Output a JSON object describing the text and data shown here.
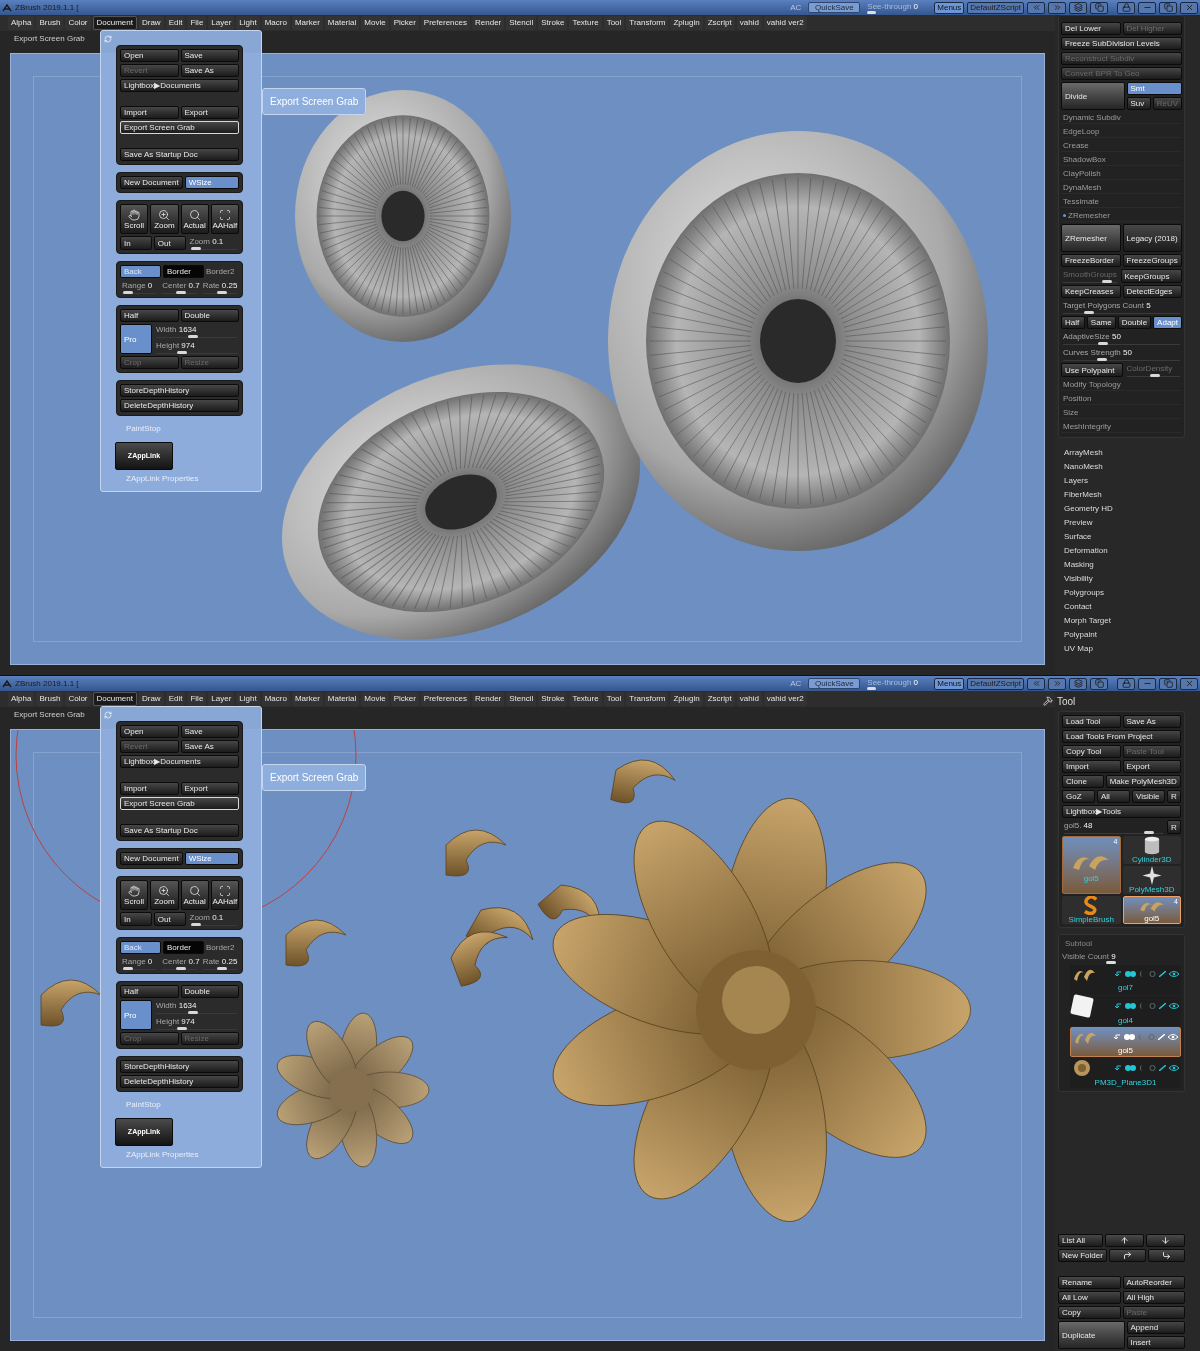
{
  "windows": [
    {
      "title": "ZBrush 2019.1.1 [",
      "topbar": {
        "ac": "AC",
        "quicksave": "QuickSave",
        "see_through": "See-through",
        "see_through_value": "0",
        "level": 0,
        "menus": "Menus",
        "menus_active": true,
        "script": "DefaultZScript"
      },
      "menu_items": [
        {
          "label": "Alpha",
          "selected": false
        },
        {
          "label": "Brush",
          "selected": false
        },
        {
          "label": "Color",
          "selected": false
        },
        {
          "label": "Document",
          "selected": true
        },
        {
          "label": "Draw",
          "selected": false
        },
        {
          "label": "Edit",
          "selected": false
        },
        {
          "label": "File",
          "selected": false
        },
        {
          "label": "Layer",
          "selected": false
        },
        {
          "label": "Light",
          "selected": false
        },
        {
          "label": "Macro",
          "selected": false
        },
        {
          "label": "Marker",
          "selected": false
        },
        {
          "label": "Material",
          "selected": false
        },
        {
          "label": "Movie",
          "selected": false
        },
        {
          "label": "Picker",
          "selected": false
        },
        {
          "label": "Preferences",
          "selected": false
        },
        {
          "label": "Render",
          "selected": false
        },
        {
          "label": "Stencil",
          "selected": false
        },
        {
          "label": "Stroke",
          "selected": false
        },
        {
          "label": "Texture",
          "selected": false
        },
        {
          "label": "Tool",
          "selected": false
        },
        {
          "label": "Transform",
          "selected": false
        },
        {
          "label": "Zplugin",
          "selected": false
        },
        {
          "label": "Zscript",
          "selected": false
        },
        {
          "label": "vahid",
          "selected": false
        },
        {
          "label": "vahid ver2",
          "selected": false
        }
      ],
      "status_text": "Export Screen Grab",
      "canvas": {
        "kind": "eyes"
      },
      "document_menu": {
        "groups": [
          [
            [
              {
                "label": "Open"
              },
              {
                "label": "Save"
              }
            ],
            [
              {
                "label": "Revert",
                "disabled": true
              },
              {
                "label": "Save As"
              }
            ],
            [
              {
                "label": "Lightbox▶Documents"
              }
            ],
            [
              {
                "kind": "spacer"
              }
            ],
            [
              {
                "label": "Import"
              },
              {
                "label": "Export"
              }
            ],
            [
              {
                "label": "Export Screen Grab",
                "hovered": true
              }
            ],
            [
              {
                "kind": "spacer"
              }
            ],
            [
              {
                "label": "Save As Startup Doc"
              }
            ]
          ],
          [
            [
              {
                "label": "New Document"
              },
              {
                "label": "WSize",
                "active": true
              }
            ]
          ],
          [
            [
              {
                "kind": "tool",
                "label": "Scroll"
              },
              {
                "kind": "tool",
                "label": "Zoom"
              },
              {
                "kind": "tool",
                "label": "Actual"
              },
              {
                "kind": "tool",
                "label": "AAHalf"
              }
            ],
            [
              {
                "label": "In"
              },
              {
                "label": "Out"
              },
              {
                "kind": "slider",
                "label": "Zoom",
                "value": "0.1",
                "level": 0.05,
                "wide": true
              }
            ]
          ],
          [
            [
              {
                "label": "Back",
                "active": true,
                "disabled": true
              },
              {
                "kind": "black",
                "label": "Border"
              },
              {
                "kind": "label",
                "label": "Border2"
              }
            ],
            [
              {
                "kind": "slider",
                "label": "Range",
                "value": "0",
                "level": 0.05
              },
              {
                "kind": "slider",
                "label": "Center",
                "value": "0.7",
                "level": 0.55
              },
              {
                "kind": "slider",
                "label": "Rate",
                "value": "0.25",
                "level": 0.6
              }
            ]
          ],
          [
            [
              {
                "label": "Half"
              },
              {
                "label": "Double"
              }
            ],
            [
              {
                "kind": "block",
                "label": "Pro",
                "active": true
              },
              {
                "kind": "stack",
                "rows": [
                  [
                    {
                      "kind": "slider",
                      "label": "Width",
                      "value": "1634",
                      "level": 0.45
                    }
                  ],
                  [
                    {
                      "kind": "slider",
                      "label": "Height",
                      "value": "974",
                      "level": 0.3
                    }
                  ]
                ]
              }
            ],
            [
              {
                "label": "Crop",
                "disabled": true
              },
              {
                "label": "Resize",
                "disabled": true
              }
            ]
          ],
          [
            [
              {
                "label": "StoreDepthHistory"
              }
            ],
            [
              {
                "label": "DeleteDepthHistory"
              }
            ]
          ]
        ],
        "paintstop": "PaintStop",
        "zapplink": "ZAppLink",
        "zapplink_properties": "ZAppLink Properties"
      },
      "tooltip": "Export Screen Grab",
      "right_panel": {
        "kind": "geometry",
        "rows": [
          [
            {
              "label": "Del Lower"
            },
            {
              "label": "Del Higher",
              "disabled": true
            }
          ],
          [
            {
              "label": "Freeze SubDivision Levels"
            }
          ],
          [
            {
              "label": "Reconstruct Subdiv",
              "disabled": true
            }
          ],
          [
            {
              "label": "Convert BPR To Geo",
              "disabled": true
            }
          ],
          [
            {
              "kind": "tall",
              "label": "Divide"
            },
            {
              "kind": "stack",
              "rows": [
                [
                  {
                    "label": "Smt",
                    "active": true
                  }
                ],
                [
                  {
                    "label": "Suv"
                  },
                  {
                    "label": "ReUV",
                    "disabled": true
                  }
                ]
              ]
            }
          ],
          [
            {
              "kind": "header",
              "label": "Dynamic Subdiv",
              "expanded": false
            }
          ],
          [
            {
              "kind": "header",
              "label": "EdgeLoop",
              "expanded": false
            }
          ],
          [
            {
              "kind": "header",
              "label": "Crease",
              "expanded": false
            }
          ],
          [
            {
              "kind": "header",
              "label": "ShadowBox",
              "expanded": false
            }
          ],
          [
            {
              "kind": "header",
              "label": "ClayPolish",
              "expanded": false
            }
          ],
          [
            {
              "kind": "header",
              "label": "DynaMesh",
              "expanded": false
            }
          ],
          [
            {
              "kind": "header",
              "label": "Tessimate",
              "expanded": false
            }
          ],
          [
            {
              "kind": "header",
              "label": "ZRemesher",
              "expanded": true
            }
          ],
          [
            {
              "kind": "tall",
              "label": "ZRemesher"
            },
            {
              "label": "Legacy (2018)"
            }
          ],
          [
            {
              "label": "FreezeBorder"
            },
            {
              "label": "FreezeGroups"
            }
          ],
          [
            {
              "kind": "slider",
              "label": "SmoothGroups",
              "disabled": true,
              "level": 0.9
            },
            {
              "label": "KeepGroups"
            }
          ],
          [
            {
              "label": "KeepCreases"
            },
            {
              "label": "DetectEdges"
            }
          ],
          [
            {
              "kind": "slider",
              "label": "Target Polygons Count",
              "value": "5",
              "level": 0.2
            }
          ],
          {
            "kind": "segmented",
            "items": [
              {
                "label": "Half"
              },
              {
                "label": "Same"
              },
              {
                "label": "Double"
              },
              {
                "label": "Adapt",
                "active": true
              }
            ]
          },
          [
            {
              "kind": "slider",
              "label": "AdaptiveSize",
              "value": "50",
              "level": 0.33
            }
          ],
          [
            {
              "kind": "slider",
              "label": "Curves Strength",
              "value": "50",
              "level": 0.32
            }
          ],
          [
            {
              "label": "Use Polypaint"
            },
            {
              "kind": "slider",
              "label": "ColorDensity",
              "disabled": true,
              "level": 0.55
            }
          ],
          [
            {
              "kind": "header",
              "label": "Modify Topology",
              "expanded": false
            }
          ],
          [
            {
              "kind": "header",
              "label": "Position",
              "expanded": false
            }
          ],
          [
            {
              "kind": "header",
              "label": "Size",
              "expanded": false
            }
          ],
          [
            {
              "kind": "header",
              "label": "MeshIntegrity",
              "expanded": false
            }
          ]
        ],
        "palettes": [
          "ArrayMesh",
          "NanoMesh",
          "Layers",
          "FiberMesh",
          "Geometry HD",
          "Preview",
          "Surface",
          "Deformation",
          "Masking",
          "Visibility",
          "Polygroups",
          "Contact",
          "Morph Target",
          "Polypaint",
          "UV Map"
        ]
      }
    },
    {
      "title": "ZBrush 2019.1.1 [",
      "topbar": {
        "ac": "AC",
        "quicksave": "QuickSave",
        "see_through": "See-through",
        "see_through_value": "0",
        "level": 0,
        "menus": "Menus",
        "menus_active": true,
        "script": "DefaultZScript"
      },
      "menu_items": [
        {
          "label": "Alpha",
          "selected": false
        },
        {
          "label": "Brush",
          "selected": false
        },
        {
          "label": "Color",
          "selected": false
        },
        {
          "label": "Document",
          "selected": true
        },
        {
          "label": "Draw",
          "selected": false
        },
        {
          "label": "Edit",
          "selected": false
        },
        {
          "label": "File",
          "selected": false
        },
        {
          "label": "Layer",
          "selected": false
        },
        {
          "label": "Light",
          "selected": false
        },
        {
          "label": "Macro",
          "selected": false
        },
        {
          "label": "Marker",
          "selected": false
        },
        {
          "label": "Material",
          "selected": false
        },
        {
          "label": "Movie",
          "selected": false
        },
        {
          "label": "Picker",
          "selected": false
        },
        {
          "label": "Preferences",
          "selected": false
        },
        {
          "label": "Render",
          "selected": false
        },
        {
          "label": "Stencil",
          "selected": false
        },
        {
          "label": "Stroke",
          "selected": false
        },
        {
          "label": "Texture",
          "selected": false
        },
        {
          "label": "Tool",
          "selected": false
        },
        {
          "label": "Transform",
          "selected": false
        },
        {
          "label": "Zplugin",
          "selected": false
        },
        {
          "label": "Zscript",
          "selected": false
        },
        {
          "label": "vahid",
          "selected": false
        },
        {
          "label": "vahid ver2",
          "selected": false
        }
      ],
      "status_text": "Export Screen Grab",
      "canvas": {
        "kind": "flowers"
      },
      "document_menu": {
        "groups": [
          [
            [
              {
                "label": "Open"
              },
              {
                "label": "Save"
              }
            ],
            [
              {
                "label": "Revert",
                "disabled": true
              },
              {
                "label": "Save As"
              }
            ],
            [
              {
                "label": "Lightbox▶Documents"
              }
            ],
            [
              {
                "kind": "spacer"
              }
            ],
            [
              {
                "label": "Import"
              },
              {
                "label": "Export"
              }
            ],
            [
              {
                "label": "Export Screen Grab",
                "hovered": true
              }
            ],
            [
              {
                "kind": "spacer"
              }
            ],
            [
              {
                "label": "Save As Startup Doc"
              }
            ]
          ],
          [
            [
              {
                "label": "New Document"
              },
              {
                "label": "WSize",
                "active": true
              }
            ]
          ],
          [
            [
              {
                "kind": "tool",
                "label": "Scroll"
              },
              {
                "kind": "tool",
                "label": "Zoom"
              },
              {
                "kind": "tool",
                "label": "Actual"
              },
              {
                "kind": "tool",
                "label": "AAHalf"
              }
            ],
            [
              {
                "label": "In"
              },
              {
                "label": "Out"
              },
              {
                "kind": "slider",
                "label": "Zoom",
                "value": "0.1",
                "level": 0.05,
                "wide": true
              }
            ]
          ],
          [
            [
              {
                "label": "Back",
                "active": true,
                "disabled": true
              },
              {
                "kind": "black",
                "label": "Border"
              },
              {
                "kind": "label",
                "label": "Border2"
              }
            ],
            [
              {
                "kind": "slider",
                "label": "Range",
                "value": "0",
                "level": 0.05
              },
              {
                "kind": "slider",
                "label": "Center",
                "value": "0.7",
                "level": 0.55
              },
              {
                "kind": "slider",
                "label": "Rate",
                "value": "0.25",
                "level": 0.6
              }
            ]
          ],
          [
            [
              {
                "label": "Half"
              },
              {
                "label": "Double"
              }
            ],
            [
              {
                "kind": "block",
                "label": "Pro",
                "active": true
              },
              {
                "kind": "stack",
                "rows": [
                  [
                    {
                      "kind": "slider",
                      "label": "Width",
                      "value": "1634",
                      "level": 0.45
                    }
                  ],
                  [
                    {
                      "kind": "slider",
                      "label": "Height",
                      "value": "974",
                      "level": 0.3
                    }
                  ]
                ]
              }
            ],
            [
              {
                "label": "Crop",
                "disabled": true
              },
              {
                "label": "Resize",
                "disabled": true
              }
            ]
          ],
          [
            [
              {
                "label": "StoreDepthHistory"
              }
            ],
            [
              {
                "label": "DeleteDepthHistory"
              }
            ]
          ]
        ],
        "paintstop": "PaintStop",
        "zapplink": "ZAppLink",
        "zapplink_properties": "ZAppLink Properties"
      },
      "tooltip": "Export Screen Grab",
      "right_panel": {
        "kind": "tool",
        "title": "Tool",
        "rows": [
          [
            {
              "label": "Load Tool"
            },
            {
              "label": "Save As"
            }
          ],
          [
            {
              "label": "Load Tools From Project"
            }
          ],
          [
            {
              "label": "Copy Tool"
            },
            {
              "label": "Paste Tool",
              "disabled": true
            }
          ],
          [
            {
              "label": "Import"
            },
            {
              "label": "Export"
            }
          ],
          [
            {
              "label": "Clone"
            },
            {
              "label": "Make PolyMesh3D",
              "wide": true
            }
          ],
          [
            {
              "label": "GoZ"
            },
            {
              "label": "All"
            },
            {
              "label": "Visible"
            },
            {
              "kind": "small",
              "label": "R"
            }
          ],
          [
            {
              "label": "Lightbox▶Tools"
            }
          ],
          [
            {
              "kind": "slider",
              "label": "gol5.",
              "value": "48",
              "level": 0.9
            },
            {
              "kind": "small",
              "label": "R"
            }
          ]
        ],
        "thumbnails": [
          {
            "label": "gol5",
            "count": "4",
            "kind": "model",
            "selected": false
          },
          {
            "label": "Cylinder3D",
            "kind": "cylinder",
            "selected": false
          },
          {
            "label": "PolyMesh3D",
            "kind": "star",
            "selected": false
          },
          {
            "label": "SimpleBrush",
            "kind": "brush",
            "selected": false
          },
          {
            "label": "gol5",
            "count": "4",
            "kind": "model",
            "selected": true
          }
        ],
        "subtool": {
          "title": "Subtool",
          "count_label": "Visible Count",
          "count_value": "9",
          "level": 0.4,
          "items": [
            {
              "name": "gol7",
              "kind": "model",
              "selected": false
            },
            {
              "name": "gol4",
              "kind": "cube",
              "selected": false
            },
            {
              "name": "gol5",
              "kind": "model",
              "selected": true
            },
            {
              "name": "PM3D_Plane3D1",
              "kind": "flower",
              "selected": false
            }
          ]
        },
        "bottom_rows": [
          [
            {
              "label": "List All"
            },
            {
              "kind": "iconbutton"
            },
            {
              "kind": "iconbutton"
            }
          ],
          [
            {
              "label": "New Folder"
            },
            {
              "kind": "iconbutton"
            },
            {
              "kind": "iconbutton"
            }
          ],
          [
            {
              "kind": "spacer"
            }
          ],
          [
            {
              "label": "Rename"
            },
            {
              "label": "AutoReorder"
            }
          ],
          [
            {
              "label": "All Low"
            },
            {
              "label": "All High"
            }
          ],
          [
            {
              "label": "Copy"
            },
            {
              "label": "Paste",
              "disabled": true
            }
          ],
          [
            {
              "kind": "tall",
              "label": "Duplicate"
            },
            {
              "kind": "stack",
              "rows": [
                [
                  {
                    "label": "Append"
                  }
                ],
                [
                  {
                    "label": "Insert"
                  }
                ]
              ]
            }
          ]
        ]
      }
    }
  ]
}
